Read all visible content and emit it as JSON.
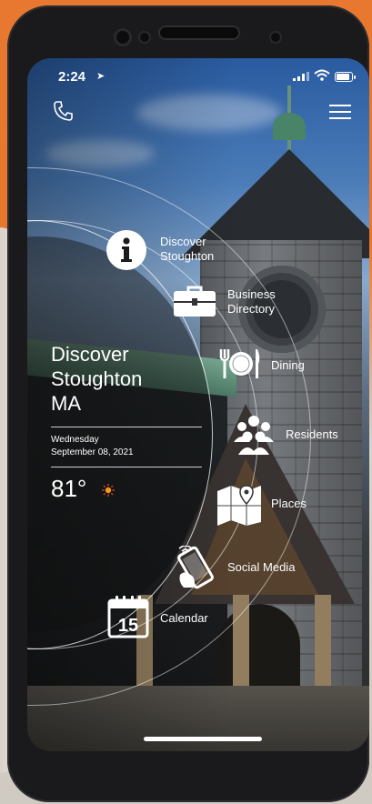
{
  "status_bar": {
    "time": "2:24"
  },
  "header": {
    "call_icon": "phone-icon",
    "menu_icon": "hamburger-menu-icon"
  },
  "hero": {
    "title_line1": "Discover",
    "title_line2": "Stoughton",
    "title_line3": "MA",
    "day": "Wednesday",
    "date": "September 08, 2021",
    "temperature": "81°",
    "weather_icon": "sun-icon"
  },
  "menu": [
    {
      "label_line1": "Discover",
      "label_line2": "Stoughton",
      "icon": "info-icon"
    },
    {
      "label_line1": "Business",
      "label_line2": "Directory",
      "icon": "briefcase-icon"
    },
    {
      "label_line1": "Dining",
      "icon": "utensils-icon"
    },
    {
      "label_line1": "Residents",
      "icon": "people-icon"
    },
    {
      "label_line1": "Places",
      "icon": "map-icon"
    },
    {
      "label_line1": "Social Media",
      "icon": "phone-hand-icon"
    },
    {
      "label_line1": "Calendar",
      "icon": "calendar-icon",
      "icon_text": "15"
    }
  ],
  "colors": {
    "background_orange": "#e8782f",
    "sun": "#f29a1b"
  }
}
